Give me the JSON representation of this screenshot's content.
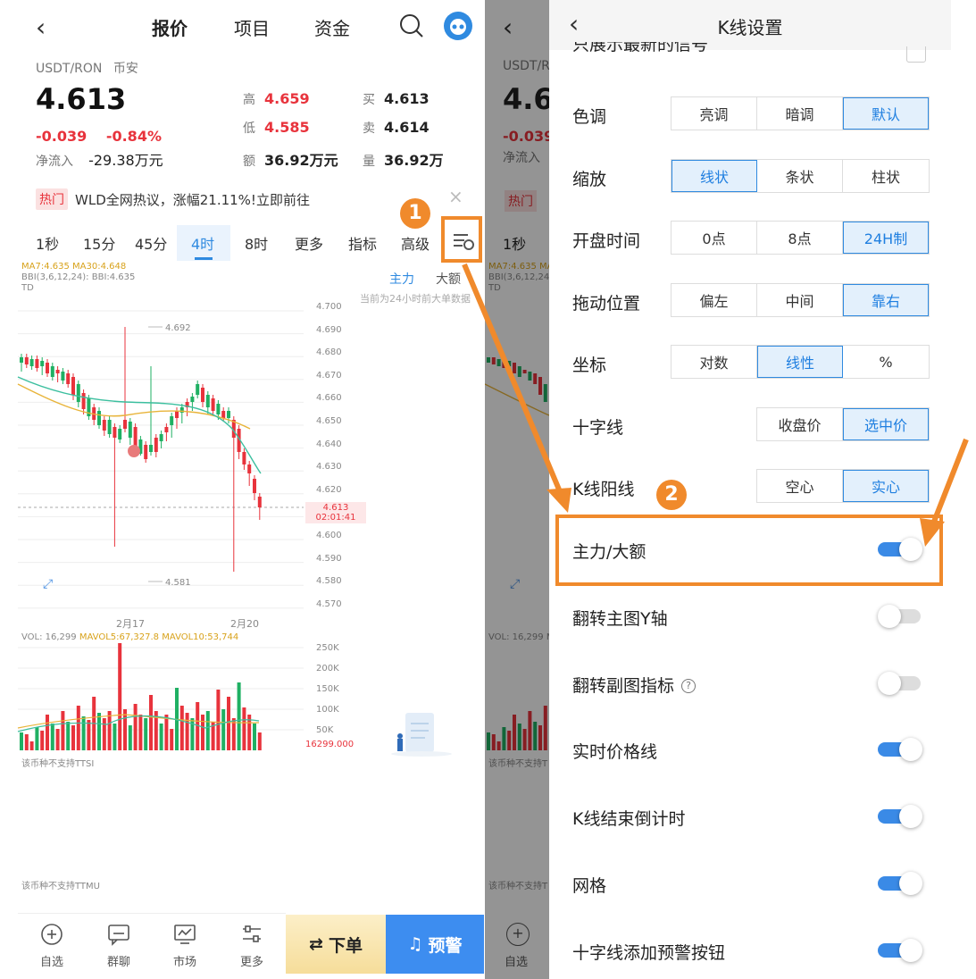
{
  "left": {
    "nav": {
      "title": "报价",
      "item2": "项目",
      "item3": "资金"
    },
    "pair": "USDT/RON",
    "exchange": "币安",
    "price": "4.613",
    "change": "-0.039",
    "change_pct": "-0.84%",
    "inflow_label": "净流入",
    "inflow_value": "-29.38万元",
    "high_label": "高",
    "high": "4.659",
    "low_label": "低",
    "low": "4.585",
    "amount_label": "额",
    "amount": "36.92万元",
    "buy_label": "买",
    "buy": "4.613",
    "sell_label": "卖",
    "sell": "4.614",
    "vol_label": "量",
    "vol": "36.92万",
    "hot_badge": "热门",
    "hot_text": "WLD全网热议，涨幅21.11%!立即前往",
    "intervals": [
      "1秒",
      "15分",
      "45分",
      "4时",
      "8时",
      "更多",
      "指标",
      "高级"
    ],
    "ma_line": "MA7:4.635 MA30:4.648",
    "bbi_line": "BBI(3,6,12,24): BBI:4.635",
    "td": "TD",
    "main_tab": "主力",
    "big_tab": "大额",
    "panel_note": "当前为24小时前大单数据",
    "price_ticks": [
      "4.700",
      "4.690",
      "4.680",
      "4.670",
      "4.660",
      "4.650",
      "4.640",
      "4.630",
      "4.620",
      "4.610",
      "4.600",
      "4.590",
      "4.580",
      "4.570"
    ],
    "current_price_tag": "4.613",
    "countdown": "02:01:41",
    "hi_mark": "4.692",
    "lo_mark": "4.581",
    "dates": [
      "2月17",
      "2月20"
    ],
    "vol_line": "VOL: 16,299",
    "mavol5": "MAVOL5:67,327.8",
    "mavol10": "MAVOL10:53,744",
    "vol_ticks": [
      "250K",
      "200K",
      "150K",
      "100K",
      "50K"
    ],
    "vol_current": "16299.000",
    "ttsi_note": "该币种不支持TTSI",
    "ttmu_note": "该币种不支持TTMU",
    "tabbar": [
      "自选",
      "群聊",
      "市场",
      "更多"
    ],
    "order_btn": "下单",
    "alert_btn": "预警",
    "badge1": "1"
  },
  "middle": {
    "pair_partial": "USDT/R",
    "price_partial": "4.6",
    "change_partial": "-0.039",
    "inflow_partial": "净流入",
    "hot_partial": "热门",
    "interval_partial": "1秒",
    "ma_partial": "MA7:4.635 MA",
    "bbi_partial": "BBI(3,6,12,24)",
    "td": "TD",
    "vol_partial": "VOL: 16,299 M",
    "ttsi_partial": "该币种不支持T",
    "ttmu_partial": "该币种不支持T",
    "tab_partial": "自选"
  },
  "settings": {
    "title": "K线设置",
    "top_partial": "只展示最新的信号",
    "rows": [
      {
        "label": "色调",
        "options": [
          "亮调",
          "暗调",
          "默认"
        ],
        "selected": 2
      },
      {
        "label": "缩放",
        "options": [
          "线状",
          "条状",
          "柱状"
        ],
        "selected": 0
      },
      {
        "label": "开盘时间",
        "options": [
          "0点",
          "8点",
          "24H制"
        ],
        "selected": 2
      },
      {
        "label": "拖动位置",
        "options": [
          "偏左",
          "中间",
          "靠右"
        ],
        "selected": 2
      },
      {
        "label": "坐标",
        "options": [
          "对数",
          "线性",
          "%"
        ],
        "selected": 1
      },
      {
        "label": "十字线",
        "options": [
          "收盘价",
          "选中价"
        ],
        "selected": 1
      },
      {
        "label": "K线阳线",
        "options": [
          "空心",
          "实心"
        ],
        "selected": 1
      }
    ],
    "toggles": [
      {
        "label": "主力/大额",
        "on": true
      },
      {
        "label": "翻转主图Y轴",
        "on": false
      },
      {
        "label": "翻转副图指标",
        "on": false,
        "info": "?"
      },
      {
        "label": "实时价格线",
        "on": true
      },
      {
        "label": "K线结束倒计时",
        "on": true
      },
      {
        "label": "网格",
        "on": true
      },
      {
        "label": "十字线添加预警按钮",
        "on": true
      }
    ],
    "badge2": "2"
  },
  "colors": {
    "up": "#e8333c",
    "down": "#1fb063",
    "accent": "#2f8ae0",
    "annotation": "#f08a2c"
  }
}
